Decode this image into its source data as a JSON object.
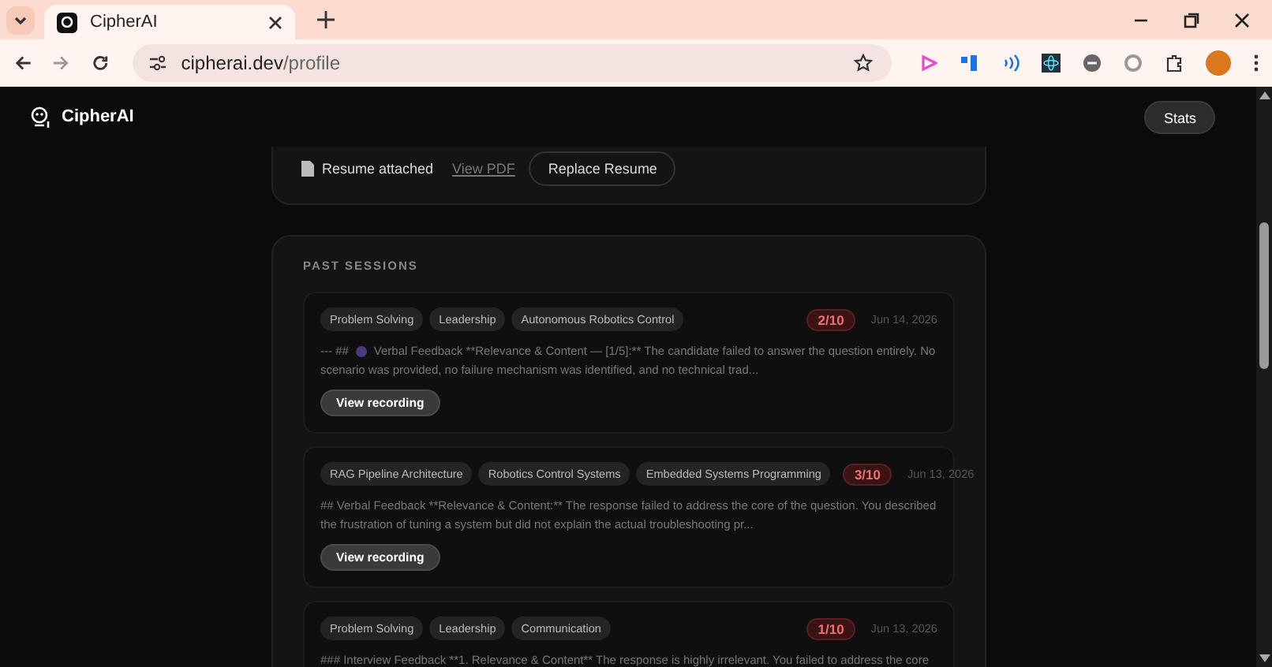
{
  "browser": {
    "tab_title": "CipherAI",
    "url_host": "cipherai.dev",
    "url_path": "/profile"
  },
  "header": {
    "brand": "CipherAI",
    "stats_button": "Stats"
  },
  "resume": {
    "status": "Resume attached",
    "view_link": "View PDF",
    "replace_button": "Replace Resume"
  },
  "past_sessions": {
    "title": "PAST SESSIONS",
    "sessions": [
      {
        "tags": [
          "Problem Solving",
          "Leadership",
          "Autonomous Robotics Control"
        ],
        "score": "2/10",
        "date": "Jun 14, 2026",
        "feedback_prefix": "--- ##",
        "feedback_lines": [
          "Verbal Feedback **Relevance & Content — [1/5]:** The candidate failed to answer the question entirely. No",
          "scenario was provided, no failure mechanism was identified, and no technical trad..."
        ],
        "button": "View recording"
      },
      {
        "tags": [
          "RAG Pipeline Architecture",
          "Robotics Control Systems",
          "Embedded Systems Programming"
        ],
        "score": "3/10",
        "date": "Jun 13, 2026",
        "feedback_lines": [
          "## Verbal Feedback **Relevance & Content:** The response failed to address the core of the question. You described",
          "the frustration of tuning a system but did not explain the actual troubleshooting pr..."
        ],
        "button": "View recording"
      },
      {
        "tags": [
          "Problem Solving",
          "Leadership",
          "Communication"
        ],
        "score": "1/10",
        "date": "Jun 13, 2026",
        "feedback_lines": [
          "### Interview Feedback **1. Relevance & Content** The response is highly irrelevant. You failed to address the core"
        ]
      }
    ]
  }
}
